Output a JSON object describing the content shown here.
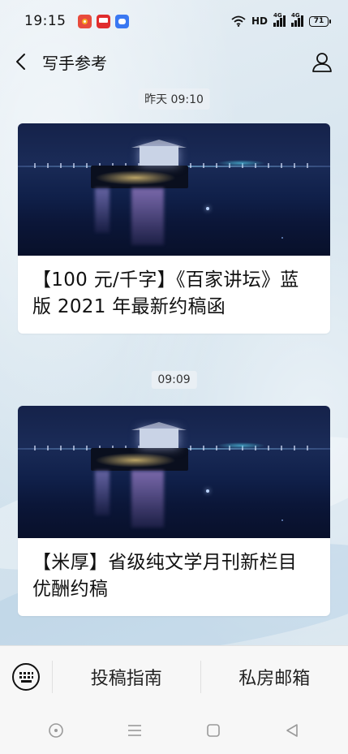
{
  "status_bar": {
    "time": "19:15",
    "network_label": "HD",
    "sig1_label": "4G",
    "sig2_label": "4G",
    "battery": "71",
    "notification_icons": [
      "weibo-app-icon",
      "red-app-icon",
      "blue-app-icon"
    ]
  },
  "header": {
    "title": "写手参考"
  },
  "messages": [
    {
      "timestamp": "昨天 09:10",
      "title": "【100 元/千字】《百家讲坛》蓝版 2021 年最新约稿函"
    },
    {
      "timestamp": "09:09",
      "title": "【米厚】省级纯文学月刊新栏目优酬约稿"
    }
  ],
  "menu": {
    "items": [
      "投稿指南",
      "私房邮箱"
    ]
  },
  "colors": {
    "background": "#dfeaf1",
    "card": "#ffffff",
    "menu_bar": "#f7f7f7"
  }
}
